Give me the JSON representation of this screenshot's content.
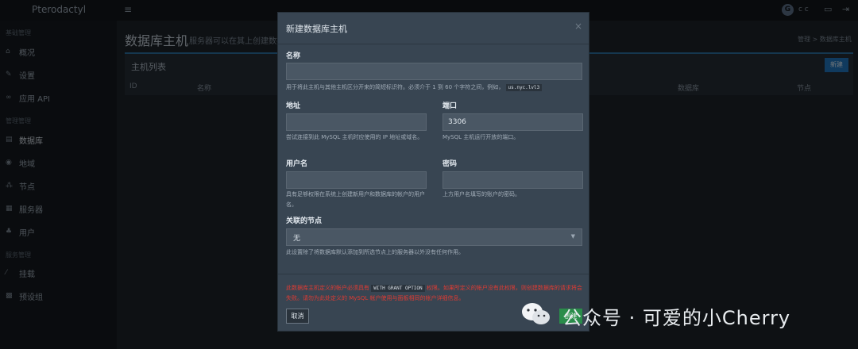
{
  "topbar": {
    "brand": "Pterodactyl",
    "menu_icon": "hamburger-icon",
    "avatar_letter": "G",
    "user_name": "c c",
    "icons": [
      "window-icon",
      "logout-icon"
    ]
  },
  "sidebar": {
    "section1": "基础管理",
    "section2": "管理管理",
    "section3": "服务管理",
    "items": [
      {
        "label": "概况",
        "icon": "home-icon"
      },
      {
        "label": "设置",
        "icon": "wrench-icon"
      },
      {
        "label": "应用 API",
        "icon": "link-icon"
      },
      {
        "label": "数据库",
        "icon": "database-icon"
      },
      {
        "label": "地域",
        "icon": "globe-icon"
      },
      {
        "label": "节点",
        "icon": "sitemap-icon"
      },
      {
        "label": "服务器",
        "icon": "server-icon"
      },
      {
        "label": "用户",
        "icon": "users-icon"
      },
      {
        "label": "挂载",
        "icon": "magic-icon"
      },
      {
        "label": "预设组",
        "icon": "th-large-icon"
      }
    ]
  },
  "main": {
    "title": "数据库主机",
    "subtitle": "服务器可以在其上创建数据",
    "breadcrumb": "管理 > 数据库主机",
    "panel_title": "主机列表",
    "new_button": "新建",
    "columns": [
      "ID",
      "名称",
      "数据库",
      "节点"
    ]
  },
  "modal": {
    "title": "新建数据库主机",
    "close_icon": "close-icon",
    "name_label": "名称",
    "name_value": "",
    "name_help": "用于将此主机与其他主机区分开来的简短标识符。必须介于 1 到 60 个字符之间，例如，",
    "name_help_code": "us.nyc.lvl3",
    "host_label": "地址",
    "host_value": "",
    "host_help": "尝试连接到此 MySQL 主机时应使用的 IP 地址或域名。",
    "port_label": "端口",
    "port_value": "3306",
    "port_help": "MySQL 主机运行开放的端口。",
    "user_label": "用户名",
    "user_value": "",
    "user_help": "具有足够权限在系统上创建新用户和数据库的帐户的用户名。",
    "pass_label": "密码",
    "pass_value": "",
    "pass_help": "上方用户名填写的账户的密码。",
    "node_label": "关联的节点",
    "node_value": "无",
    "node_help": "此设置除了将数据库默认添加到所选节点上的服务器以外没有任何作用。",
    "warn_part1": "此数据库主机定义的帐户必须具有",
    "warn_code": "WITH GRANT OPTION",
    "warn_part2": "权限。如果所定义的帐户没有此权限，则创建数据库的请求将会失败。请勿为此处定义的 MySQL 帐户使用与面板相同的帐户详细信息。",
    "cancel_button": "取消",
    "create_button": "创建"
  },
  "watermark": {
    "text": "公众号 · 可爱的小Cherry"
  }
}
